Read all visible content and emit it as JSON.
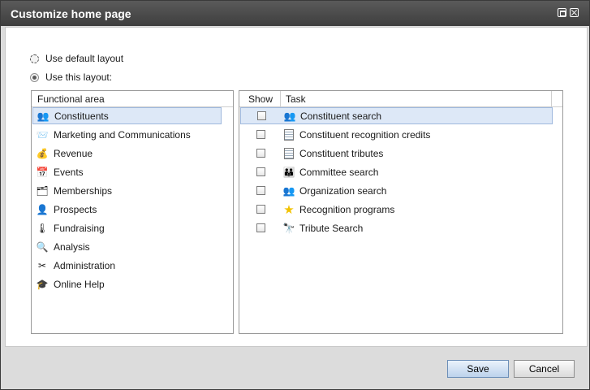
{
  "window": {
    "title": "Customize home page"
  },
  "layout_options": {
    "default_label": "Use default layout",
    "custom_label": "Use this layout:",
    "selected": "custom"
  },
  "functional_area": {
    "header": "Functional area",
    "items": [
      {
        "label": "Constituents",
        "icon": "constituents-icon",
        "glyph": "👥",
        "selected": true
      },
      {
        "label": "Marketing and Communications",
        "icon": "marketing-icon",
        "glyph": "📨",
        "selected": false
      },
      {
        "label": "Revenue",
        "icon": "revenue-icon",
        "glyph": "💰",
        "selected": false
      },
      {
        "label": "Events",
        "icon": "events-icon",
        "glyph": "📅",
        "selected": false
      },
      {
        "label": "Memberships",
        "icon": "memberships-icon",
        "glyph": "🗂",
        "selected": false
      },
      {
        "label": "Prospects",
        "icon": "prospects-icon",
        "glyph": "👤",
        "selected": false
      },
      {
        "label": "Fundraising",
        "icon": "fundraising-icon",
        "glyph": "🌡",
        "selected": false
      },
      {
        "label": "Analysis",
        "icon": "analysis-icon",
        "glyph": "🔍",
        "selected": false
      },
      {
        "label": "Administration",
        "icon": "administration-icon",
        "glyph": "✂",
        "selected": false
      },
      {
        "label": "Online Help",
        "icon": "online-help-icon",
        "glyph": "🎓",
        "selected": false
      }
    ]
  },
  "tasks": {
    "show_header": "Show",
    "task_header": "Task",
    "items": [
      {
        "label": "Constituent search",
        "icon": "people-icon",
        "glyph": "👥",
        "checked": false,
        "selected": true
      },
      {
        "label": "Constituent recognition credits",
        "icon": "document-icon",
        "glyph": "",
        "checked": false,
        "selected": false
      },
      {
        "label": "Constituent tributes",
        "icon": "document-icon",
        "glyph": "",
        "checked": false,
        "selected": false
      },
      {
        "label": "Committee search",
        "icon": "committee-icon",
        "glyph": "👪",
        "checked": false,
        "selected": false
      },
      {
        "label": "Organization search",
        "icon": "people-icon",
        "glyph": "👥",
        "checked": false,
        "selected": false
      },
      {
        "label": "Recognition programs",
        "icon": "star-icon",
        "glyph": "★",
        "checked": false,
        "selected": false
      },
      {
        "label": "Tribute Search",
        "icon": "binoculars-icon",
        "glyph": "🔭",
        "checked": false,
        "selected": false
      }
    ]
  },
  "buttons": {
    "save": "Save",
    "cancel": "Cancel"
  },
  "colors": {
    "titlebar": "#474747",
    "selection": "#dde8f7",
    "selection_border": "#9fb8dd"
  }
}
